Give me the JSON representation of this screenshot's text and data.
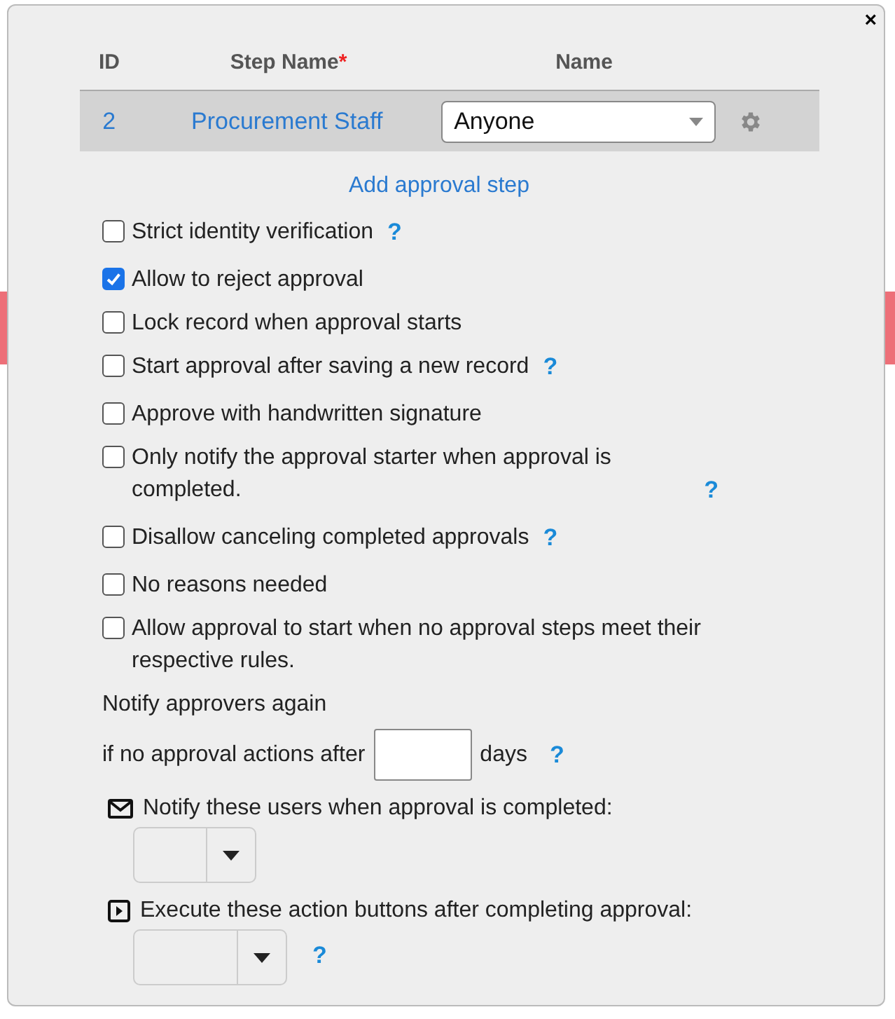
{
  "dialog": {
    "close": "×"
  },
  "table": {
    "columns": [
      {
        "label": "ID"
      },
      {
        "label": "Step Name",
        "required_mark": "*"
      },
      {
        "label": "Name"
      }
    ],
    "rows": [
      {
        "id": "2",
        "step_name": "Procurement Staff",
        "approver": "Anyone"
      }
    ]
  },
  "add_step": "Add approval step",
  "options": [
    {
      "label": "Strict identity verification",
      "checked": false,
      "help": "?"
    },
    {
      "label": "Allow to reject approval",
      "checked": true
    },
    {
      "label": "Lock record when approval starts",
      "checked": false
    },
    {
      "label": "Start approval after saving a new record",
      "checked": false,
      "help": "?"
    },
    {
      "label": "Approve with handwritten signature",
      "checked": false
    },
    {
      "label": "Only notify the approval starter when approval is completed.",
      "checked": false,
      "help": "?"
    },
    {
      "label": "Disallow canceling completed approvals",
      "checked": false,
      "help": "?"
    },
    {
      "label": "No reasons needed",
      "checked": false
    },
    {
      "label": "Allow approval to start when no approval steps meet their respective rules.",
      "checked": false
    }
  ],
  "reminder": {
    "line1": "Notify approvers again",
    "prefix": "if no approval actions after",
    "suffix": "days",
    "help": "?"
  },
  "notify_users": {
    "label": "Notify these users when approval is completed:"
  },
  "action_buttons": {
    "label": "Execute these action buttons after completing approval:",
    "help": "?"
  }
}
